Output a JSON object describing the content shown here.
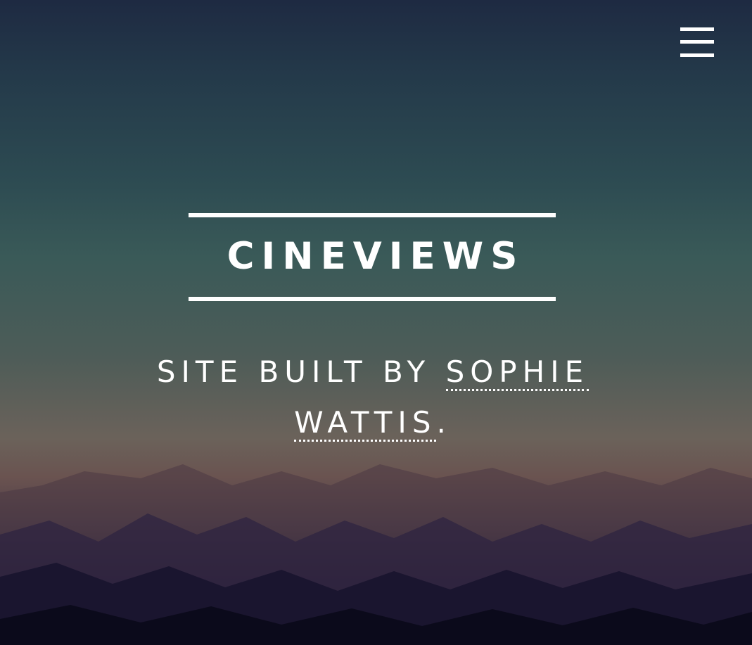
{
  "header": {
    "menu_icon": "hamburger-menu-icon"
  },
  "banner": {
    "title": "CINEVIEWS",
    "subtitle_prefix": "SITE BUILT BY ",
    "author_link": "SOPHIE WATTIS",
    "subtitle_suffix": "."
  },
  "colors": {
    "text": "#ffffff",
    "sky_top": "#1e2a42",
    "mid_teal": "#3a5a58",
    "horizon": "#6b625a",
    "ground_bottom": "#0b0a1e"
  }
}
